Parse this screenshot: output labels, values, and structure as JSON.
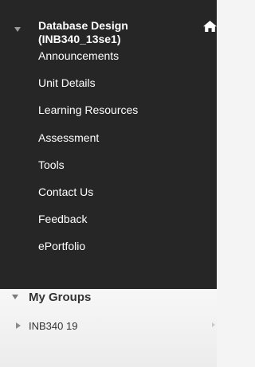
{
  "course": {
    "title_line1": "Database Design",
    "title_line2": "(INB340_13se1)",
    "menu_items": [
      "Announcements",
      "Unit Details",
      "Learning Resources",
      "Assessment",
      "Tools",
      "Contact Us",
      "Feedback",
      "ePortfolio"
    ]
  },
  "groups": {
    "title": "My Groups",
    "items": [
      "INB340 19"
    ]
  },
  "icons": {
    "course_collapse": "caret-down-icon",
    "home": "home-icon",
    "groups_collapse": "caret-down-icon",
    "group_expand": "caret-right-icon",
    "group_chevron": "chevron-right-icon"
  },
  "colors": {
    "course_background": "#262626",
    "course_text": "#ffffff",
    "groups_background": "#f2f2f2",
    "groups_text": "#333333"
  }
}
